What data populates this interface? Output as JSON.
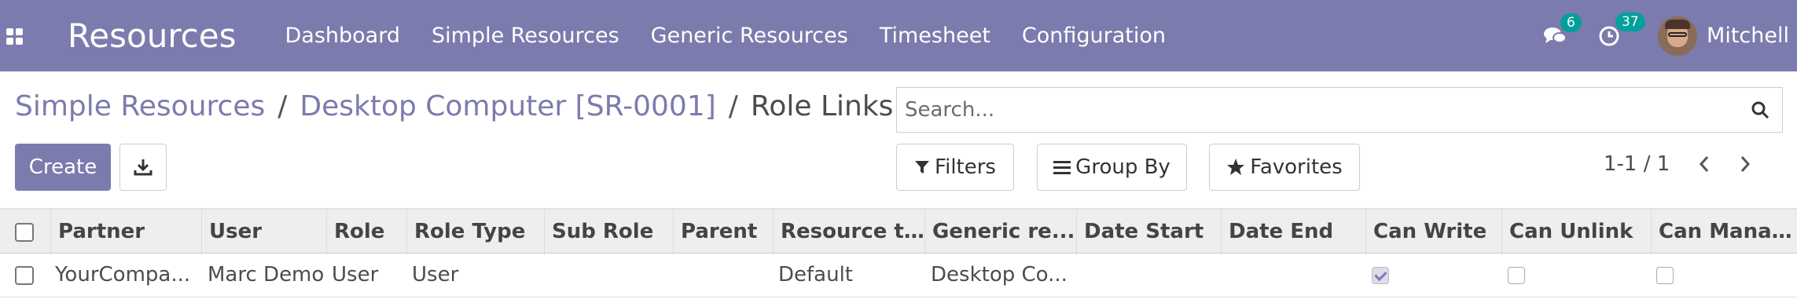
{
  "app": {
    "brand": "Resources",
    "menu": [
      "Dashboard",
      "Simple Resources",
      "Generic Resources",
      "Timesheet",
      "Configuration"
    ],
    "messages_count": "6",
    "activities_count": "37",
    "user_name": "Mitchell"
  },
  "breadcrumb": {
    "items": [
      "Simple Resources",
      "Desktop Computer [SR-0001]"
    ],
    "separator": "/",
    "current": "Role Links"
  },
  "search": {
    "placeholder": "Search..."
  },
  "toolbar": {
    "create_label": "Create",
    "filters_label": "Filters",
    "groupby_label": "Group By",
    "favorites_label": "Favorites"
  },
  "pager": {
    "value": "1-1 / 1"
  },
  "table": {
    "headers": [
      "Partner",
      "User",
      "Role",
      "Role Type",
      "Sub Role",
      "Parent",
      "Resource t...",
      "Generic re...",
      "Date Start",
      "Date End",
      "Can Write",
      "Can Unlink",
      "Can Manag..."
    ],
    "rows": [
      {
        "partner": "YourCompa...",
        "user": "Marc Demo",
        "role": "User",
        "role_type": "User",
        "sub_role": "",
        "parent": "",
        "resource_type": "Default",
        "generic_resource": "Desktop Co...",
        "date_start": "",
        "date_end": "",
        "can_write": true,
        "can_unlink": false,
        "can_manage": false
      }
    ]
  },
  "colors": {
    "brand": "#7c7bad",
    "badge": "#00a09d"
  }
}
